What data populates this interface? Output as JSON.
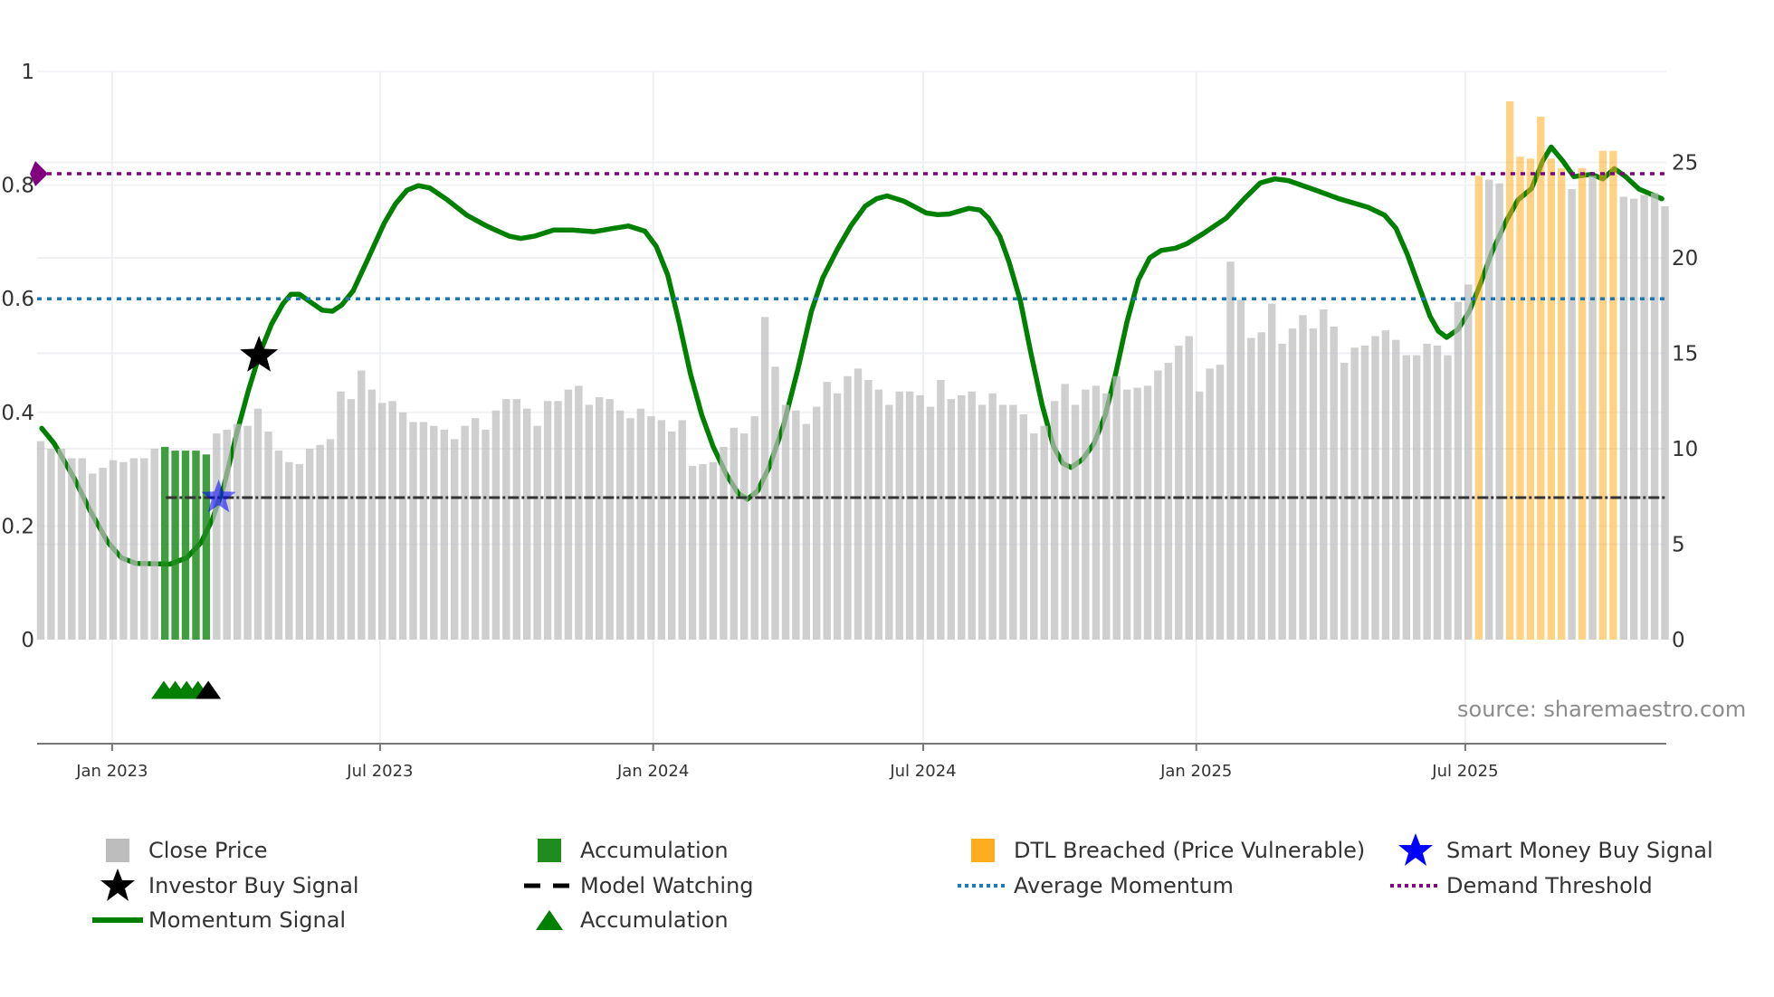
{
  "chart_data": {
    "type": "bar+line",
    "x_unit": "week index",
    "x_ticks": [
      {
        "label": "Jan 2023",
        "week": 6.9
      },
      {
        "label": "Jul 2023",
        "week": 32.8
      },
      {
        "label": "Jan 2024",
        "week": 59.2
      },
      {
        "label": "Jul 2024",
        "week": 85.3
      },
      {
        "label": "Jan 2025",
        "week": 111.7
      },
      {
        "label": "Jul 2025",
        "week": 137.7
      }
    ],
    "left_axis": {
      "range": [
        -0.183,
        1.0
      ],
      "ticks": [
        0,
        0.2,
        0.4,
        0.6,
        0.8,
        1
      ],
      "tick_labels": [
        "0",
        "0.2",
        "0.4",
        "0.6",
        "0.8",
        "1"
      ]
    },
    "right_axis": {
      "range": [
        0,
        29.8
      ],
      "ticks": [
        0,
        5,
        10,
        15,
        20,
        25
      ],
      "tick_labels": [
        "0",
        "5",
        "10",
        "15",
        "20",
        "25"
      ]
    },
    "close_price": [
      10.4,
      10.0,
      10.0,
      9.5,
      9.5,
      8.7,
      9.0,
      9.4,
      9.3,
      9.5,
      9.5,
      10.0,
      10.1,
      9.9,
      9.9,
      9.9,
      9.7,
      10.8,
      11.0,
      11.3,
      11.2,
      12.1,
      10.9,
      9.9,
      9.3,
      9.2,
      10.0,
      10.2,
      10.5,
      13.0,
      12.6,
      14.1,
      13.1,
      12.4,
      12.5,
      11.9,
      11.4,
      11.4,
      11.2,
      11.0,
      10.5,
      11.2,
      11.6,
      11.0,
      12.0,
      12.6,
      12.6,
      12.1,
      11.2,
      12.5,
      12.5,
      13.1,
      13.3,
      12.3,
      12.7,
      12.6,
      12.0,
      11.6,
      12.1,
      11.7,
      11.5,
      10.9,
      11.5,
      9.1,
      9.2,
      9.3,
      10.1,
      11.1,
      10.8,
      11.7,
      16.9,
      14.3,
      12.3,
      12.0,
      11.3,
      12.2,
      13.5,
      12.9,
      13.8,
      14.2,
      13.6,
      13.1,
      12.3,
      13.0,
      13.0,
      12.8,
      12.2,
      13.6,
      12.6,
      12.8,
      13.0,
      12.3,
      12.9,
      12.3,
      12.3,
      11.8,
      10.8,
      11.2,
      12.5,
      13.4,
      12.3,
      13.1,
      13.3,
      12.9,
      13.8,
      13.1,
      13.2,
      13.3,
      14.1,
      14.5,
      15.4,
      15.9,
      13.0,
      14.2,
      14.4,
      19.8,
      17.8,
      15.8,
      16.1,
      17.6,
      15.5,
      16.3,
      17.0,
      16.3,
      17.3,
      16.4,
      14.5,
      15.3,
      15.4,
      15.9,
      16.2,
      15.7,
      14.9,
      14.9,
      15.5,
      15.4,
      14.9,
      17.7,
      18.6,
      24.3,
      24.1,
      23.9,
      28.2,
      25.3,
      25.2,
      27.4,
      25.2,
      24.7,
      23.6,
      24.7,
      24.3,
      25.6,
      25.6,
      23.2,
      23.1,
      23.3,
      23.4,
      22.7
    ],
    "accumulation_weeks": [
      12,
      13,
      14,
      15,
      16
    ],
    "dtl_breached_weeks": [
      139,
      142,
      143,
      144,
      145,
      146,
      147,
      149,
      151,
      152
    ],
    "momentum": [
      [
        0.1,
        0.372
      ],
      [
        1.3,
        0.345
      ],
      [
        3.2,
        0.285
      ],
      [
        4.8,
        0.226
      ],
      [
        6.5,
        0.171
      ],
      [
        7.8,
        0.144
      ],
      [
        9.2,
        0.134
      ],
      [
        12.5,
        0.133
      ],
      [
        14.1,
        0.144
      ],
      [
        15.5,
        0.171
      ],
      [
        16.6,
        0.212
      ],
      [
        17.7,
        0.27
      ],
      [
        19.0,
        0.367
      ],
      [
        20.1,
        0.44
      ],
      [
        21.2,
        0.505
      ],
      [
        22.3,
        0.555
      ],
      [
        23.4,
        0.591
      ],
      [
        24.2,
        0.608
      ],
      [
        25.0,
        0.608
      ],
      [
        26.1,
        0.594
      ],
      [
        27.2,
        0.58
      ],
      [
        28.2,
        0.578
      ],
      [
        29.1,
        0.589
      ],
      [
        30.2,
        0.614
      ],
      [
        31.6,
        0.669
      ],
      [
        33.2,
        0.733
      ],
      [
        34.3,
        0.767
      ],
      [
        35.4,
        0.791
      ],
      [
        36.5,
        0.799
      ],
      [
        37.6,
        0.795
      ],
      [
        39.3,
        0.774
      ],
      [
        41.2,
        0.747
      ],
      [
        43.1,
        0.728
      ],
      [
        45.3,
        0.71
      ],
      [
        46.4,
        0.706
      ],
      [
        47.7,
        0.71
      ],
      [
        49.6,
        0.721
      ],
      [
        51.3,
        0.721
      ],
      [
        53.5,
        0.718
      ],
      [
        55.4,
        0.724
      ],
      [
        56.8,
        0.728
      ],
      [
        58.4,
        0.719
      ],
      [
        59.5,
        0.692
      ],
      [
        60.6,
        0.642
      ],
      [
        61.7,
        0.559
      ],
      [
        62.8,
        0.468
      ],
      [
        63.9,
        0.395
      ],
      [
        65.0,
        0.34
      ],
      [
        66.3,
        0.29
      ],
      [
        67.4,
        0.258
      ],
      [
        68.3,
        0.247
      ],
      [
        69.3,
        0.262
      ],
      [
        70.4,
        0.303
      ],
      [
        71.8,
        0.377
      ],
      [
        73.2,
        0.477
      ],
      [
        74.5,
        0.578
      ],
      [
        75.6,
        0.637
      ],
      [
        77.0,
        0.687
      ],
      [
        78.3,
        0.728
      ],
      [
        79.7,
        0.763
      ],
      [
        80.8,
        0.776
      ],
      [
        81.8,
        0.781
      ],
      [
        83.4,
        0.772
      ],
      [
        85.6,
        0.751
      ],
      [
        86.7,
        0.748
      ],
      [
        87.8,
        0.749
      ],
      [
        89.7,
        0.759
      ],
      [
        90.8,
        0.756
      ],
      [
        91.6,
        0.742
      ],
      [
        92.7,
        0.71
      ],
      [
        93.6,
        0.665
      ],
      [
        94.7,
        0.596
      ],
      [
        95.7,
        0.505
      ],
      [
        96.8,
        0.413
      ],
      [
        97.9,
        0.34
      ],
      [
        98.8,
        0.31
      ],
      [
        99.6,
        0.303
      ],
      [
        100.7,
        0.317
      ],
      [
        101.8,
        0.345
      ],
      [
        102.9,
        0.395
      ],
      [
        103.9,
        0.468
      ],
      [
        105.0,
        0.559
      ],
      [
        106.1,
        0.633
      ],
      [
        107.2,
        0.672
      ],
      [
        108.3,
        0.685
      ],
      [
        109.7,
        0.689
      ],
      [
        110.8,
        0.697
      ],
      [
        112.4,
        0.715
      ],
      [
        114.6,
        0.742
      ],
      [
        116.5,
        0.779
      ],
      [
        117.9,
        0.804
      ],
      [
        119.3,
        0.811
      ],
      [
        120.6,
        0.808
      ],
      [
        123.4,
        0.79
      ],
      [
        125.5,
        0.776
      ],
      [
        128.3,
        0.761
      ],
      [
        129.9,
        0.747
      ],
      [
        131.0,
        0.724
      ],
      [
        132.1,
        0.678
      ],
      [
        133.2,
        0.623
      ],
      [
        134.3,
        0.569
      ],
      [
        135.1,
        0.543
      ],
      [
        135.9,
        0.532
      ],
      [
        137.0,
        0.546
      ],
      [
        138.1,
        0.578
      ],
      [
        139.2,
        0.628
      ],
      [
        140.3,
        0.683
      ],
      [
        141.7,
        0.738
      ],
      [
        142.8,
        0.774
      ],
      [
        144.1,
        0.794
      ],
      [
        145.2,
        0.843
      ],
      [
        146.0,
        0.867
      ],
      [
        147.1,
        0.843
      ],
      [
        148.2,
        0.815
      ],
      [
        149.9,
        0.819
      ],
      [
        151.0,
        0.811
      ],
      [
        152.1,
        0.829
      ],
      [
        153.2,
        0.815
      ],
      [
        154.5,
        0.793
      ],
      [
        156.7,
        0.776
      ]
    ],
    "demand_threshold": 0.82,
    "average_momentum": 0.6,
    "model_watching": {
      "value": 0.25,
      "from_week": 10
    },
    "investor_buy_signals": [
      {
        "week": 21.1,
        "value": 0.5
      }
    ],
    "smart_money_buy_signals": [
      {
        "week": 17.2,
        "value": 0.25
      }
    ],
    "accumulation_markers": [
      {
        "week": 11.9,
        "value": -0.09
      },
      {
        "week": 13.0,
        "value": -0.09
      },
      {
        "week": 14.1,
        "value": -0.09
      },
      {
        "week": 15.2,
        "value": -0.09
      }
    ],
    "watch_markers": [
      {
        "week": 16.2,
        "value": -0.09
      }
    ],
    "legend_placement": "bottom"
  },
  "colors": {
    "close_price": "#bdbdbd",
    "accumulation": "#1e8c1e",
    "dtl_breached": "#ffad1f",
    "momentum": "#008000",
    "average_momentum": "#1f77b4",
    "demand_threshold": "#800080",
    "model_watching": "#333333",
    "smart_money": "#0000ff",
    "investor": "#000000"
  },
  "legend": {
    "close_price": "Close Price",
    "accumulation_bar": "Accumulation",
    "dtl_breached": "DTL Breached (Price Vulnerable)",
    "smart_money": "Smart Money Buy Signal",
    "investor_buy": "Investor Buy Signal",
    "model_watching": "Model Watching",
    "average_momentum": "Average Momentum",
    "demand_threshold": "Demand Threshold",
    "momentum_signal": "Momentum Signal",
    "accumulation_marker": "Accumulation"
  },
  "source": "source: sharemaestro.com"
}
